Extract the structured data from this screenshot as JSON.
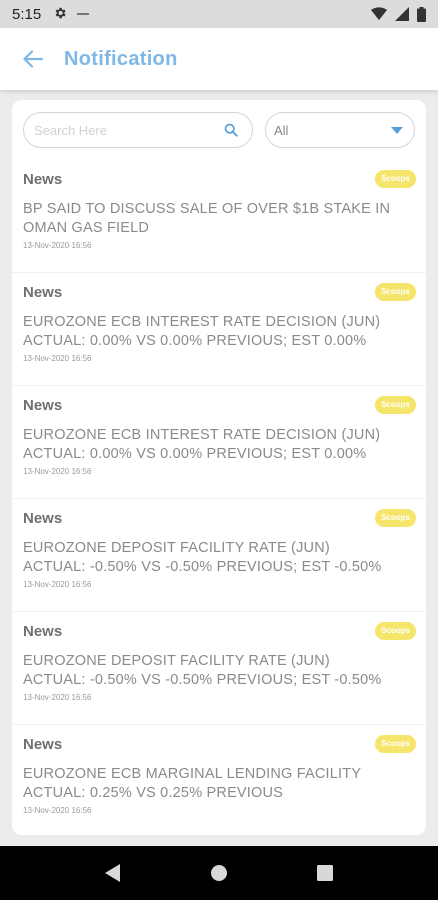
{
  "status_bar": {
    "time": "5:15",
    "icons": [
      "gear-icon",
      "wifi-icon",
      "signal-icon",
      "battery-icon"
    ]
  },
  "app_bar": {
    "title": "Notification",
    "back_icon": "arrow-left-icon",
    "accent_color": "#7fb7e6"
  },
  "filters": {
    "search_placeholder": "Search Here",
    "search_value": "",
    "select_value": "All"
  },
  "notifications": [
    {
      "category": "News",
      "badge": "Scoops",
      "headline": "BP SAID TO DISCUSS SALE OF OVER $1B STAKE IN OMAN GAS FIELD",
      "time": "13-Nov-2020 16:56"
    },
    {
      "category": "News",
      "badge": "Scoops",
      "headline": "EUROZONE ECB INTEREST RATE DECISION (JUN) ACTUAL: 0.00% VS 0.00% PREVIOUS; EST 0.00%",
      "time": "13-Nov-2020 16:56"
    },
    {
      "category": "News",
      "badge": "Scoops",
      "headline": "EUROZONE ECB INTEREST RATE DECISION (JUN) ACTUAL: 0.00% VS 0.00% PREVIOUS; EST 0.00%",
      "time": "13-Nov-2020 16:56"
    },
    {
      "category": "News",
      "badge": "Scoops",
      "headline": "EUROZONE DEPOSIT FACILITY RATE (JUN) ACTUAL: -0.50% VS -0.50% PREVIOUS; EST -0.50%",
      "time": "13-Nov-2020 16:56"
    },
    {
      "category": "News",
      "badge": "Scoops",
      "headline": "EUROZONE DEPOSIT FACILITY RATE (JUN) ACTUAL: -0.50% VS -0.50% PREVIOUS; EST -0.50%",
      "time": "13-Nov-2020 16:56"
    },
    {
      "category": "News",
      "badge": "Scoops",
      "headline": "EUROZONE ECB MARGINAL LENDING FACILITY ACTUAL: 0.25% VS 0.25% PREVIOUS",
      "time": "13-Nov-2020 16:56"
    }
  ],
  "colors": {
    "badge_bg": "#f5e56b",
    "badge_text": "#ffffff",
    "page_bg": "#ececec"
  },
  "nav_bar": {
    "icons": [
      "back-triangle-icon",
      "home-circle-icon",
      "recents-square-icon"
    ]
  }
}
